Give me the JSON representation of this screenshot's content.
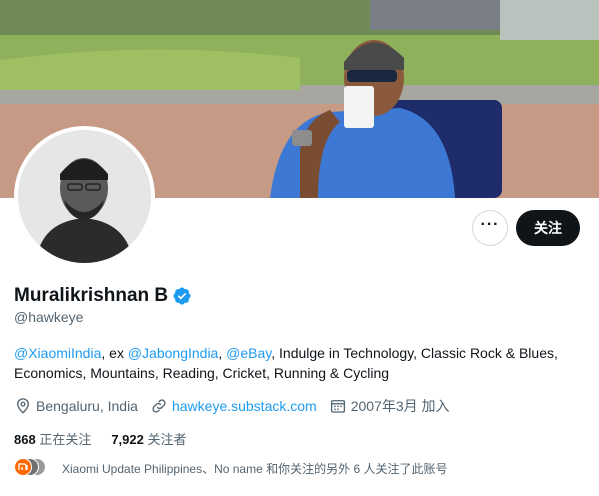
{
  "profile": {
    "name": "Muralikrishnan B",
    "handle": "@hawkeye",
    "follow_label": "关注",
    "more_icon": "more-horizontal-icon",
    "bio": {
      "mention_1": "@XiaomiIndia",
      "text_1": ", ex ",
      "mention_2": "@JabongIndia",
      "text_2": ", ",
      "mention_3": "@eBay",
      "text_3": ", Indulge in Technology, Classic Rock & Blues, Economics, Mountains, Reading, Cricket, Running & Cycling"
    },
    "location": "Bengaluru, India",
    "website": "hawkeye.substack.com",
    "joined": "2007年3月 加入",
    "following_count": "868",
    "following_label": " 正在关注",
    "followers_count": "7,922",
    "followers_label": " 关注者",
    "followed_by": "Xiaomi Update Philippines、No name 和你关注的另外 6 人关注了此账号"
  },
  "colors": {
    "accent": "#1d9bf0",
    "text_primary": "#0f1419",
    "text_secondary": "#536471",
    "follow_bg": "#0f1419"
  },
  "icons": {
    "verified": "verified-badge-icon",
    "location": "location-pin-icon",
    "link": "link-icon",
    "calendar": "calendar-icon"
  }
}
